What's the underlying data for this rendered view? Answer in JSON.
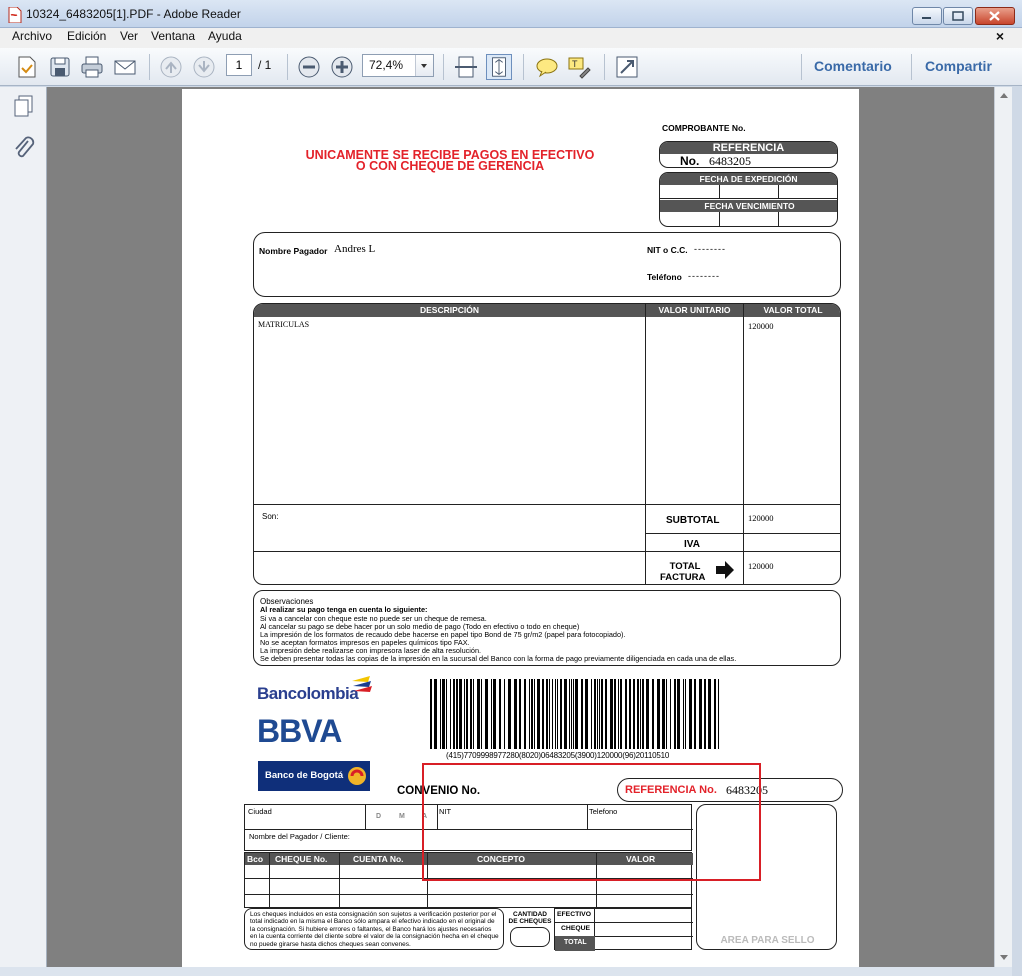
{
  "window": {
    "title": "10324_6483205[1].PDF - Adobe Reader"
  },
  "menu": {
    "items": [
      "Archivo",
      "Edición",
      "Ver",
      "Ventana",
      "Ayuda"
    ],
    "close_glyph": "×"
  },
  "toolbar": {
    "page_current": "1",
    "page_total": "/ 1",
    "zoom": "72,4%",
    "comment_label": "Comentario",
    "share_label": "Compartir",
    "icons": [
      "create-pdf-icon",
      "save-icon",
      "print-icon",
      "email-icon",
      "prev-page-icon",
      "next-page-icon",
      "zoom-out-icon",
      "zoom-in-icon",
      "fit-page-icon",
      "fit-width-icon",
      "comment-icon",
      "highlight-icon",
      "fullscreen-icon"
    ]
  },
  "document": {
    "comprobante_label": "COMPROBANTE No.",
    "referencia_header": "REFERENCIA",
    "no_label": "No.",
    "reference_number": "6483205",
    "payment_notice_line1": "UNICAMENTE SE RECIBE PAGOS EN EFECTIVO",
    "payment_notice_line2": "O CON CHEQUE DE GERENCIA",
    "fecha_expedicion": "FECHA DE EXPEDICIÓN",
    "fecha_vencimiento": "FECHA VENCIMIENTO",
    "nombre_pagador_label": "Nombre Pagador",
    "nombre_pagador_value": "Andres L",
    "nit_label": "NIT o C.C.",
    "nit_value": "--------",
    "telefono_label": "Teléfono",
    "telefono_value": "--------",
    "col_descripcion": "DESCRIPCIÓN",
    "col_valor_unitario": "VALOR UNITARIO",
    "col_valor_total": "VALOR TOTAL",
    "item_description": "MATRICULAS",
    "item_total": "120000",
    "son_label": "Son:",
    "subtotal_label": "SUBTOTAL",
    "subtotal_value": "120000",
    "iva_label": "IVA",
    "total_label_1": "TOTAL",
    "total_label_2": "FACTURA",
    "total_value": "120000",
    "observaciones_title": "Observaciones",
    "observaciones_lines": [
      "Al realizar su pago tenga en cuenta lo siguiente:",
      "Si va a cancelar con cheque este no puede ser un cheque de remesa.",
      "Al cancelar su pago se debe hacer por un solo medio de pago (Todo en efectivo o todo en cheque)",
      "La impresión de los formatos de recaudo debe hacerse en papel tipo Bond de 75 gr/m2 (papel para fotocopiado).",
      "No se aceptan formatos impresos en papeles químicos tipo FAX.",
      "La impresión debe realizarse con impresora laser de alta resolución.",
      "Se deben presentar todas las copias de la impresión en la sucursal del Banco con la forma de pago previamente diligenciada en cada una de ellas."
    ],
    "bank1": "Bancolombia",
    "bank2": "BBVA",
    "bank3": "Banco de Bogotá",
    "barcode_text": "(415)7709998977280(8020)06483205(3900)120000(96)20110510",
    "convenio_label": "CONVENIO No.",
    "referencia_no_label": "REFERENCIA No.",
    "ciudad_label": "Ciudad",
    "d_label": "D",
    "m_label": "M",
    "a_label": "A",
    "nit_short": "NIT",
    "telefono_short": "Telefono",
    "nombre_cliente_label": "Nombre del Pagador / Cliente:",
    "slip_cols": [
      "Bco",
      "CHEQUE No.",
      "CUENTA No.",
      "CONCEPTO",
      "VALOR"
    ],
    "cheques_disclaimer": "Los cheques incluidos en esta consignación son sujetos a verificación posterior por el total indicado en la misma el Banco sólo ampara el efectivo indicado en el original de la consignación. Si hubiere errores o faltantes, el Banco hará los ajustes necesarios en la cuenta corriente del cliente sobre el valor de la consignación hecha en el cheque no puede girarse hasta dichos cheques sean convenes.",
    "cantidad_cheques": "CANTIDAD DE CHEQUES",
    "efectivo_label": "EFECTIVO",
    "cheque_label": "CHEQUE",
    "total_short": "TOTAL",
    "area_sello": "AREA PARA SELLO"
  },
  "colors": {
    "accent_red": "#e3222a",
    "header_dark": "#555555",
    "link_blue": "#3a6aa8"
  }
}
